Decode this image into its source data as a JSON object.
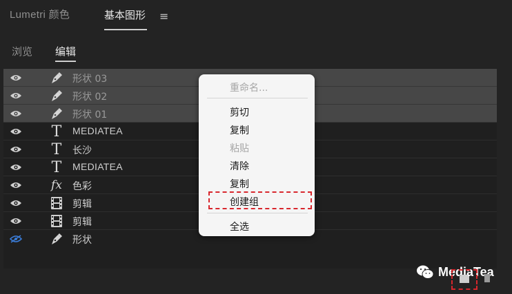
{
  "panel_tabs": {
    "lumetri": "Lumetri 颜色",
    "essential_graphics": "基本图形",
    "menu_icon": "hamburger-menu-icon"
  },
  "sub_tabs": {
    "browse": "浏览",
    "edit": "编辑"
  },
  "layers": [
    {
      "label": "形状 03",
      "icon": "pen-icon",
      "visible": true,
      "selected": true
    },
    {
      "label": "形状 02",
      "icon": "pen-icon",
      "visible": true,
      "selected": true
    },
    {
      "label": "形状 01",
      "icon": "pen-icon",
      "visible": true,
      "selected": true
    },
    {
      "label": "MEDIATEA",
      "icon": "text-icon",
      "visible": true,
      "selected": false
    },
    {
      "label": "长沙",
      "icon": "text-icon",
      "visible": true,
      "selected": false
    },
    {
      "label": "MEDIATEA",
      "icon": "text-icon",
      "visible": true,
      "selected": false
    },
    {
      "label": "色彩",
      "icon": "fx-icon",
      "visible": true,
      "selected": false
    },
    {
      "label": "剪辑",
      "icon": "film-clip-icon",
      "visible": true,
      "selected": false
    },
    {
      "label": "剪辑",
      "icon": "film-clip-icon",
      "visible": true,
      "selected": false
    },
    {
      "label": "形状",
      "icon": "pen-icon",
      "visible": false,
      "selected": false
    }
  ],
  "context_menu": {
    "rename": "重命名...",
    "cut": "剪切",
    "copy": "复制",
    "paste": "粘贴",
    "clear": "清除",
    "duplicate": "复制",
    "create_group": "创建组",
    "select_all": "全选"
  },
  "watermark": {
    "text": "MediaTea",
    "icon": "wechat-icon"
  },
  "colors": {
    "background": "#232323",
    "selected_row": "#474747",
    "highlight": "#d8262c",
    "eye_hidden": "#3a7bd5"
  }
}
